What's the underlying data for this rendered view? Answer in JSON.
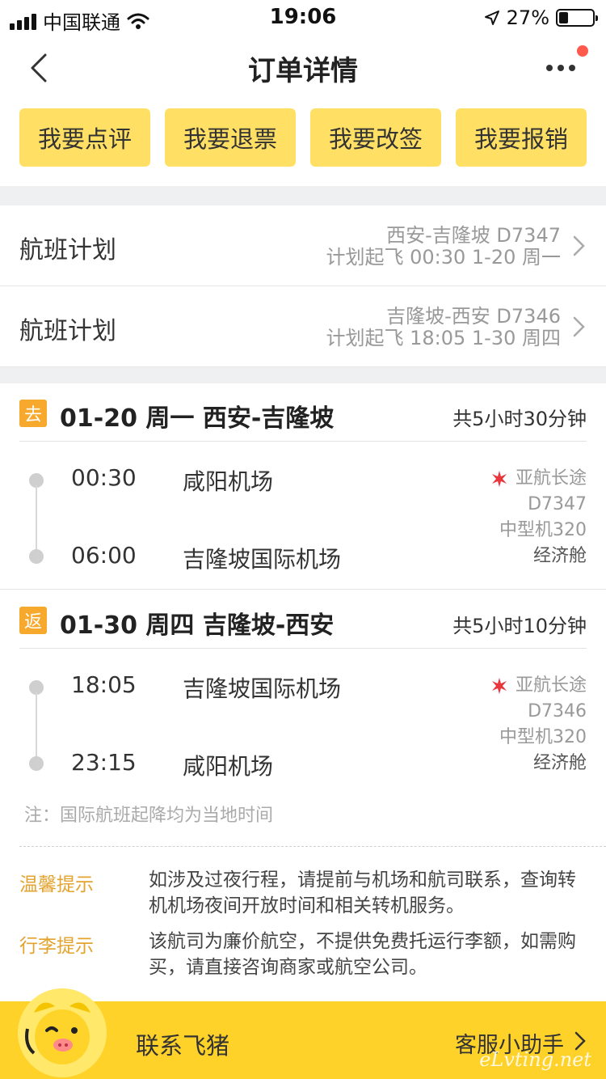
{
  "status_bar": {
    "carrier": "中国联通",
    "time": "19:06",
    "battery": "27%",
    "battery_level": 0.27
  },
  "nav": {
    "title": "订单详情"
  },
  "actions": [
    "我要点评",
    "我要退票",
    "我要改签",
    "我要报销"
  ],
  "flight_plans": [
    {
      "label": "航班计划",
      "route": "西安-吉隆坡 D7347",
      "schedule": "计划起飞 00:30 1-20 周一"
    },
    {
      "label": "航班计划",
      "route": "吉隆坡-西安 D7346",
      "schedule": "计划起飞 18:05 1-30 周四"
    }
  ],
  "segments": [
    {
      "tag": "去",
      "title": "01-20 周一 西安-吉隆坡",
      "duration": "共5小时30分钟",
      "dep_time": "00:30",
      "dep_airport": "咸阳机场",
      "arr_time": "06:00",
      "arr_airport": "吉隆坡国际机场",
      "airline": "亚航长途",
      "flight_no": "D7347",
      "aircraft": "中型机320",
      "cabin": "经济舱"
    },
    {
      "tag": "返",
      "title": "01-30 周四 吉隆坡-西安",
      "duration": "共5小时10分钟",
      "dep_time": "18:05",
      "dep_airport": "吉隆坡国际机场",
      "arr_time": "23:15",
      "arr_airport": "咸阳机场",
      "airline": "亚航长途",
      "flight_no": "D7346",
      "aircraft": "中型机320",
      "cabin": "经济舱"
    }
  ],
  "note": "注：国际航班起降均为当地时间",
  "tips": [
    {
      "label": "温馨提示",
      "text": "如涉及过夜行程，请提前与机场和航司联系，查询转机机场夜间开放时间和相关转机服务。"
    },
    {
      "label": "行李提示",
      "text": "该航司为廉价航空，不提供免费托运行李额，如需购买，请直接咨询商家或航空公司。"
    }
  ],
  "bottom_bar": {
    "contact": "联系飞猪",
    "helper": "客服小助手"
  },
  "watermark": "eLvting.net",
  "colors": {
    "accent_yellow": "#ffe065",
    "bottom_yellow": "#ffd22a",
    "tag_orange": "#f7a92e",
    "tip_label": "#e3a32e",
    "airline_red": "#e8373e"
  }
}
